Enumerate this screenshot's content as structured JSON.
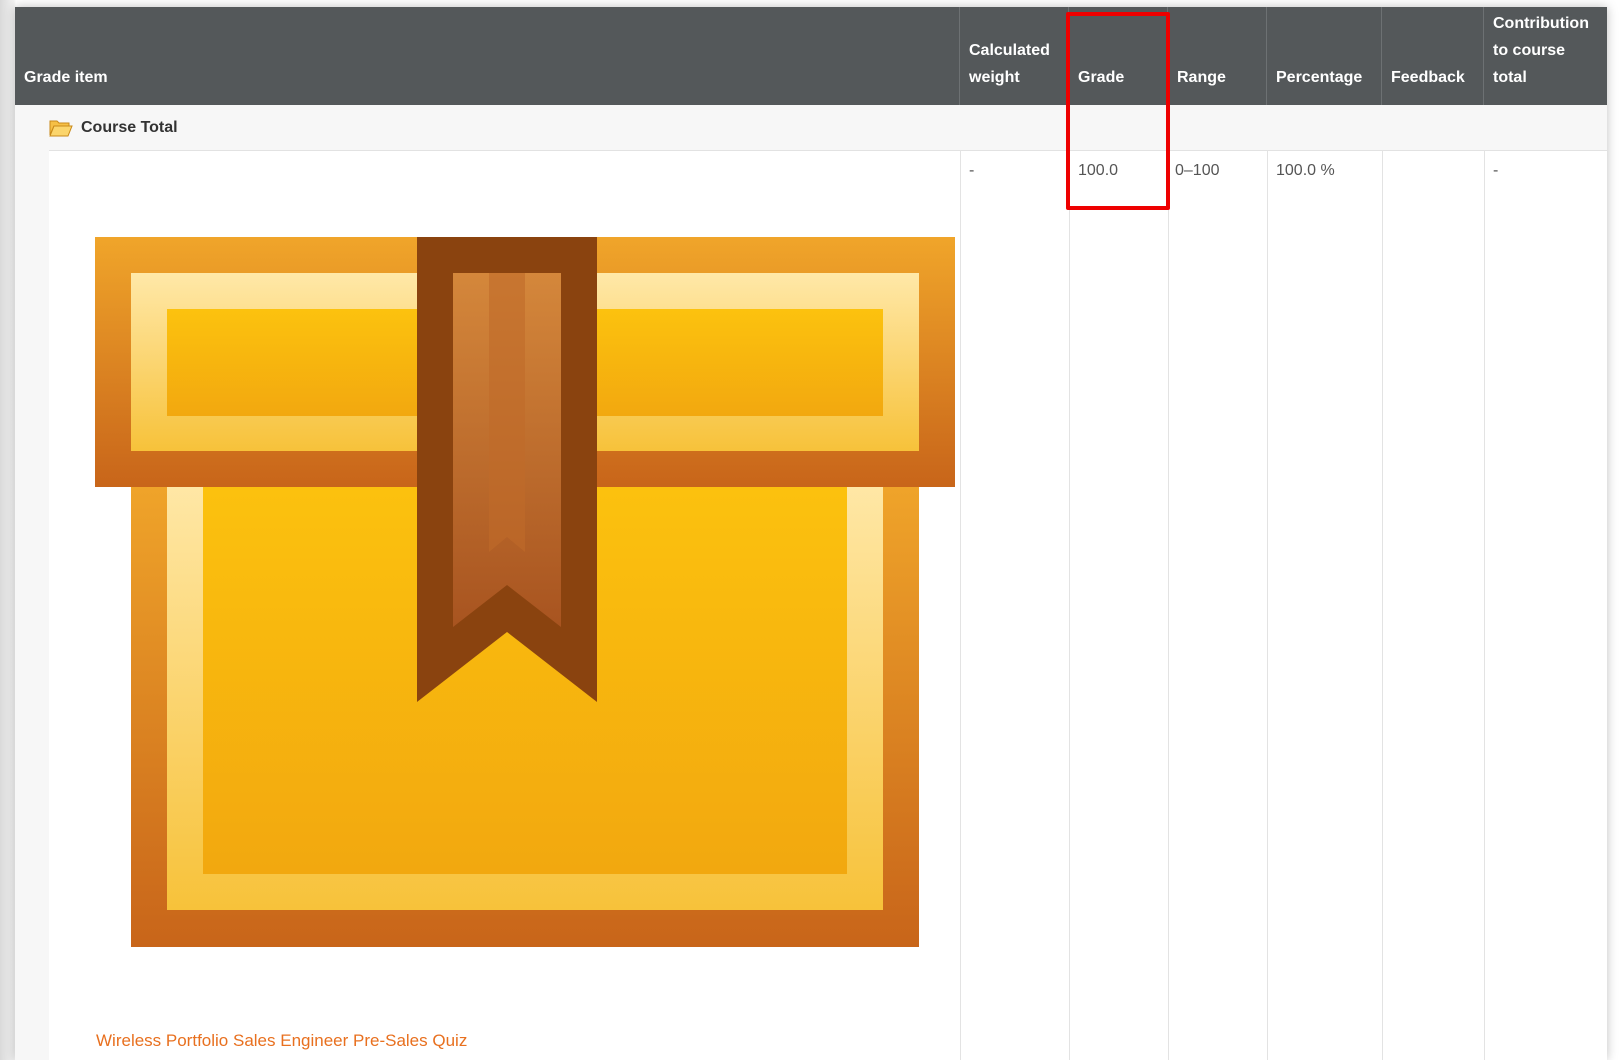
{
  "table": {
    "headers": {
      "grade_item": "Grade item",
      "calculated_weight_l1": "Calculated",
      "calculated_weight_l2": "weight",
      "grade": "Grade",
      "range": "Range",
      "percentage": "Percentage",
      "feedback": "Feedback",
      "contribution_l1": "Contribution",
      "contribution_l2": "to course",
      "contribution_l3": "total"
    },
    "course_total_label": "Course Total",
    "row": {
      "calculated_weight": "-",
      "grade": "100.0",
      "range": "0–100",
      "percentage": "100.0 %",
      "feedback": "",
      "contribution": "-"
    },
    "item_link": "Wireless Portfolio Sales Engineer Pre-Sales Quiz"
  },
  "colors": {
    "header_bg": "#54585a",
    "highlight": "#ee0000",
    "link": "#e8701f",
    "box_orange": "#f0a020",
    "ribbon_brown": "#8b4513"
  },
  "icons": {
    "folder": "folder-open-icon",
    "box": "box-ribbon-icon"
  }
}
